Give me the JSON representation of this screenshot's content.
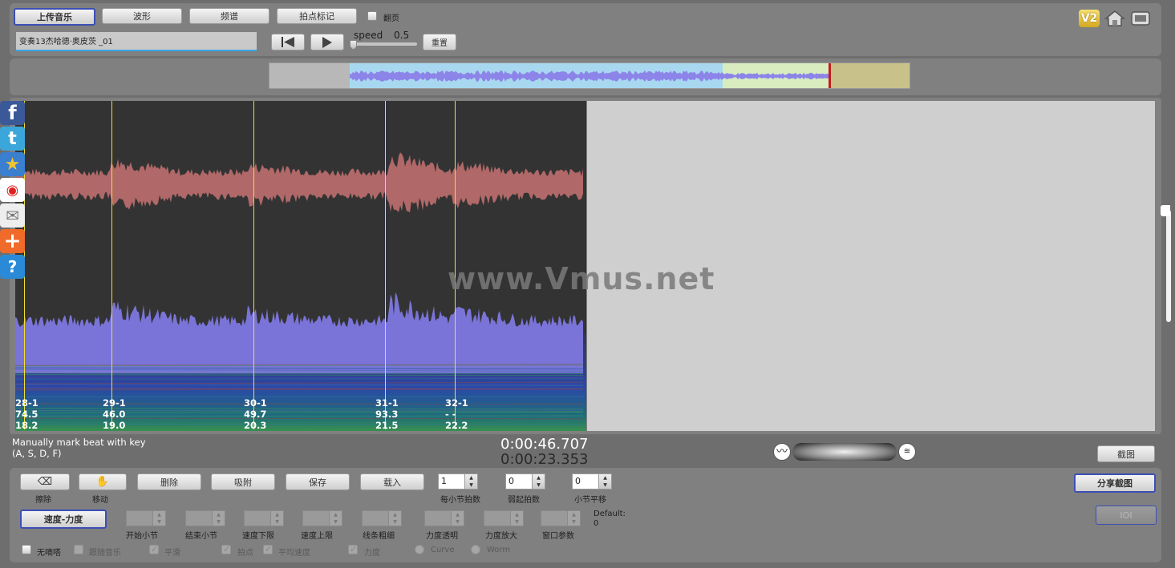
{
  "toolbar": {
    "upload_label": "上传音乐",
    "waveform_label": "波形",
    "spectrum_label": "频谱",
    "beat_mark_label": "拍点标记",
    "page_turn_label": "翻页",
    "file_name": "变奏13杰哈德·奥皮茨 _01",
    "speed_label": "speed",
    "speed_value": "0.5",
    "reset_label": "重置",
    "v2_label": "V2"
  },
  "overview": {
    "colors": {
      "played": "#a8d8f0",
      "buffered": "#d8ecc0",
      "remaining": "#c8c28a",
      "wave": "#8c84e8"
    }
  },
  "viewer": {
    "watermark": "www.Vmus.net",
    "measures": [
      {
        "label": "28-1\n74.5\n18.2"
      },
      {
        "label": "29-1\n46.0\n19.0"
      },
      {
        "label": "30-1\n49.7\n20.3"
      },
      {
        "label": "31-1\n93.3\n21.5"
      },
      {
        "label": "32-1\n- -\n22.2"
      }
    ]
  },
  "status": {
    "hint_line1": "Manually mark beat with key",
    "hint_line2": "(A, S, D, F)",
    "time_total": "0:00:46.707",
    "time_current": "0:00:23.353",
    "screenshot_label": "截图"
  },
  "controls": {
    "erase_label": "擦除",
    "move_label": "移动",
    "delete_label": "删除",
    "snap_label": "吸附",
    "save_label": "保存",
    "load_label": "载入",
    "beats_per_bar_value": "1",
    "beats_per_bar_label": "每小节拍数",
    "pickup_value": "0",
    "pickup_label": "弱起拍数",
    "bar_shift_value": "0",
    "bar_shift_label": "小节平移",
    "share_label": "分享截图",
    "ioi_label": "IOI",
    "tempo_dynamics_label": "速度-力度",
    "start_bar_label": "开始小节",
    "end_bar_label": "结束小节",
    "tempo_min_label": "速度下限",
    "tempo_max_label": "速度上限",
    "line_width_label": "线条粗细",
    "dyn_opacity_label": "力度透明",
    "dyn_scale_label": "力度放大",
    "window_param_label": "窗口参数",
    "default_label": "Default:",
    "default_value": "0",
    "no_ticks_label": "无嘀嗒",
    "follow_music_label": "跟随音乐",
    "smooth_label": "平滑",
    "beats_label": "拍点",
    "avg_tempo_label": "平均速度",
    "dynamics_label": "力度",
    "curve_label": "Curve",
    "worm_label": "Worm"
  }
}
